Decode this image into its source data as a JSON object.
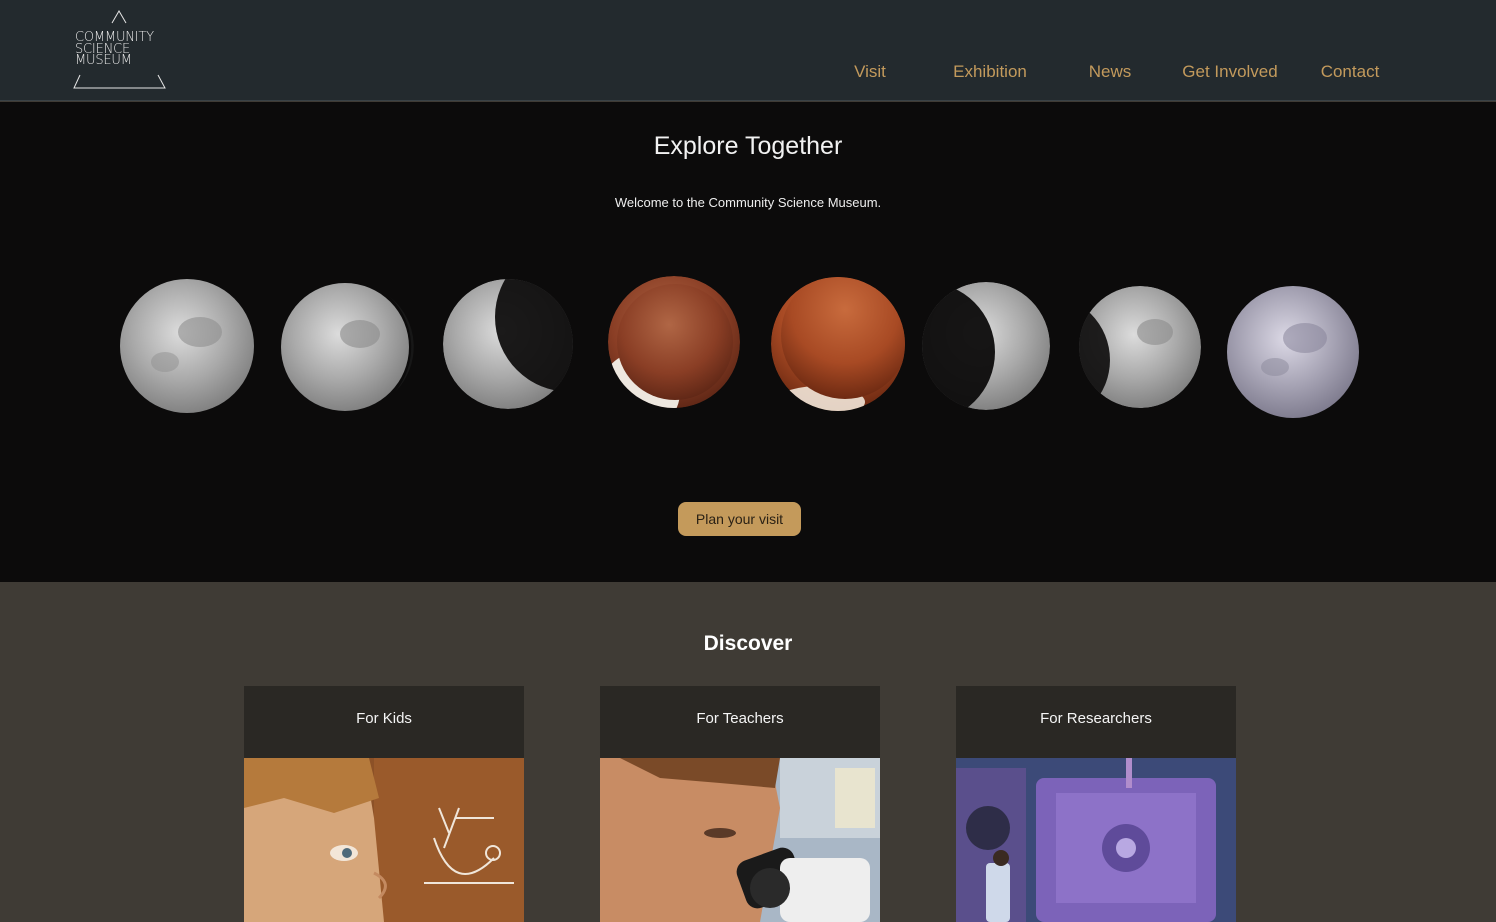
{
  "header": {
    "logo": {
      "lines": [
        "COMMUNITY",
        "SCIENCE",
        "MUSEUM"
      ]
    },
    "nav": [
      {
        "label": "Visit"
      },
      {
        "label": "Exhibition"
      },
      {
        "label": "News"
      },
      {
        "label": "Get Involved"
      },
      {
        "label": "Contact"
      }
    ]
  },
  "hero": {
    "title": "Explore Together",
    "subtitle": "Welcome to the Community Science Museum.",
    "cta_label": "Plan your visit"
  },
  "discover": {
    "title": "Discover",
    "cards": [
      {
        "title": "For Kids"
      },
      {
        "title": "For Teachers"
      },
      {
        "title": "For Researchers"
      }
    ]
  },
  "colors": {
    "header_bg": "#232a2e",
    "accent": "#c49a5b",
    "hero_bg": "#0c0b0b",
    "section_bg": "#3f3b35",
    "card_bg": "#2a2824"
  }
}
